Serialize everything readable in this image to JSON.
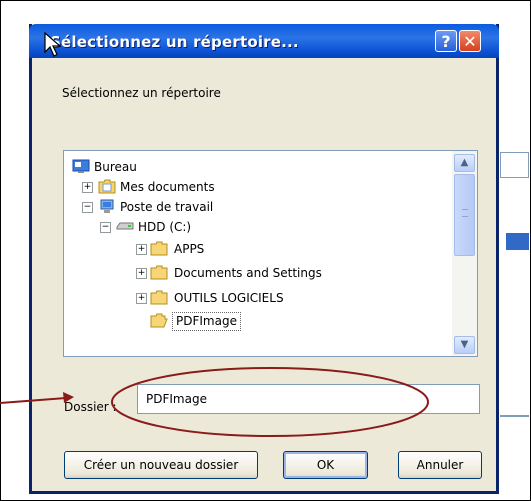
{
  "dialog": {
    "title": "Sélectionnez un répertoire...",
    "prompt": "Sélectionnez un répertoire",
    "help_label": "?",
    "close_label": "✕"
  },
  "tree": {
    "items": [
      {
        "label": "Bureau",
        "icon": "desktop-icon",
        "expander": ""
      },
      {
        "label": "Mes documents",
        "icon": "my-documents-folder-icon",
        "expander": "+"
      },
      {
        "label": "Poste de travail",
        "icon": "my-computer-icon",
        "expander": "−"
      },
      {
        "label": "HDD (C:)",
        "icon": "hard-drive-icon",
        "expander": "−"
      },
      {
        "label": "APPS",
        "icon": "folder-icon",
        "expander": "+"
      },
      {
        "label": "Documents and Settings",
        "icon": "folder-icon",
        "expander": "+"
      },
      {
        "label": "OUTILS LOGICIELS",
        "icon": "folder-icon",
        "expander": "+"
      },
      {
        "label": "PDFImage",
        "icon": "open-folder-icon",
        "expander": ""
      }
    ],
    "selected": "PDFImage"
  },
  "folder_field": {
    "label": "Dossier :",
    "value": "PDFImage"
  },
  "buttons": {
    "create": "Créer un nouveau dossier",
    "ok": "OK",
    "cancel": "Annuler"
  },
  "colors": {
    "titlebar": "#0b5be0",
    "dialog_bg": "#ece9d8",
    "annotation": "#8b1a1a"
  }
}
